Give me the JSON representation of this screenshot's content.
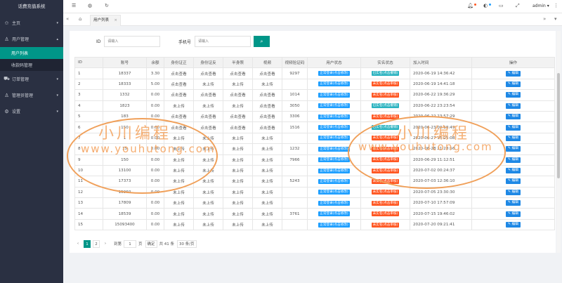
{
  "sidebar": {
    "title": "话费充值系统",
    "items": [
      {
        "icon": "star-icon",
        "glyph": "✩",
        "label": "主页",
        "chev": "▾"
      },
      {
        "icon": "user-icon",
        "glyph": "♙",
        "label": "用户管理",
        "chev": "▴"
      },
      {
        "icon": "cart-icon",
        "glyph": "⛟",
        "label": "订单管理",
        "chev": "▾"
      },
      {
        "icon": "admin-icon",
        "glyph": "♙",
        "label": "管理员管理",
        "chev": "▾"
      },
      {
        "icon": "gear-icon",
        "glyph": "⚙",
        "label": "设置",
        "chev": "▾"
      }
    ],
    "subitems": [
      {
        "label": "用户列表"
      },
      {
        "label": "收款码管理"
      }
    ]
  },
  "topbar": {
    "user": "admin ▾"
  },
  "tabs": {
    "active_label": "用户列表",
    "close": "×"
  },
  "search": {
    "id_label": "ID",
    "id_placeholder": "请输入",
    "phone_label": "手机号",
    "phone_placeholder": "请输入"
  },
  "table": {
    "columns": [
      "ID",
      "账号",
      "余额",
      "身份证正",
      "身份证反",
      "半身照",
      "视频",
      "视频验证码",
      "用户状态",
      "实名状态",
      "加入时间",
      "操作"
    ],
    "edit_label": "✎ 编辑",
    "rows": [
      {
        "id": "1",
        "acc": "18337",
        "bal": "3.30",
        "a": "点击查看",
        "b": "点击查看",
        "c": "点击查看",
        "d": "点击查看",
        "code": "9297",
        "status": "正常登录(点击修改)",
        "real": "已实名(点击撤销)",
        "real_kind": "teal",
        "time": "2020-06-19 14:36:42"
      },
      {
        "id": "2",
        "acc": "18333",
        "bal": "5.00",
        "a": "点击查看",
        "b": "未上传",
        "c": "未上传",
        "d": "未上传",
        "code": "",
        "status": "正常登录(点击修改)",
        "real": "未实名(点击审核)",
        "real_kind": "orange",
        "time": "2020-06-19 14:41:18"
      },
      {
        "id": "3",
        "acc": "1332",
        "bal": "0.00",
        "a": "点击查看",
        "b": "点击查看",
        "c": "点击查看",
        "d": "点击查看",
        "code": "1014",
        "status": "正常登录(点击修改)",
        "real": "未实名(点击审核)",
        "real_kind": "orange",
        "time": "2020-06-22 19:36:29"
      },
      {
        "id": "4",
        "acc": "1823",
        "bal": "0.00",
        "a": "未上传",
        "b": "未上传",
        "c": "未上传",
        "d": "点击查看",
        "code": "3050",
        "status": "正常登录(点击修改)",
        "real": "已实名(点击撤销)",
        "real_kind": "teal",
        "time": "2020-06-22 23:23:54"
      },
      {
        "id": "5",
        "acc": "183",
        "bal": "0.00",
        "a": "点击查看",
        "b": "点击查看",
        "c": "点击查看",
        "d": "点击查看",
        "code": "3306",
        "status": "正常登录(点击修改)",
        "real": "未实名(点击审核)",
        "real_kind": "orange",
        "time": "2020-06-22 23:57:29"
      },
      {
        "id": "6",
        "acc": "150",
        "bal": "0.00",
        "a": "点击查看",
        "b": "点击查看",
        "c": "点击查看",
        "d": "点击查看",
        "code": "1516",
        "status": "正常登录(点击修改)",
        "real": "已实名(点击撤销)",
        "real_kind": "teal",
        "time": "2020-06-23 00:18:49"
      },
      {
        "id": "7",
        "acc": "1",
        "bal": "0.00",
        "a": "未上传",
        "b": "未上传",
        "c": "未上传",
        "d": "未上传",
        "code": "",
        "status": "正常登录(点击修改)",
        "real": "未实名(点击审核)",
        "real_kind": "orange",
        "time": "2020-06-27 15:25:08"
      },
      {
        "id": "8",
        "acc": "15",
        "bal": "0.00",
        "a": "未上传",
        "b": "未上传",
        "c": "未上传",
        "d": "未上传",
        "code": "1232",
        "status": "正常登录(点击修改)",
        "real": "未实名(点击审核)",
        "real_kind": "orange",
        "time": "2020-06-28 21:28:56"
      },
      {
        "id": "9",
        "acc": "150",
        "bal": "0.00",
        "a": "未上传",
        "b": "未上传",
        "c": "未上传",
        "d": "未上传",
        "code": "7966",
        "status": "正常登录(点击修改)",
        "real": "未实名(点击审核)",
        "real_kind": "orange",
        "time": "2020-06-29 11:12:51"
      },
      {
        "id": "10",
        "acc": "13100",
        "bal": "0.00",
        "a": "未上传",
        "b": "未上传",
        "c": "未上传",
        "d": "未上传",
        "code": "",
        "status": "正常登录(点击修改)",
        "real": "未实名(点击审核)",
        "real_kind": "orange",
        "time": "2020-07-02 00:24:37"
      },
      {
        "id": "11",
        "acc": "17373",
        "bal": "0.00",
        "a": "未上传",
        "b": "未上传",
        "c": "未上传",
        "d": "未上传",
        "code": "5243",
        "status": "正常登录(点击修改)",
        "real": "未实名(点击审核)",
        "real_kind": "orange",
        "time": "2020-07-03 12:36:10"
      },
      {
        "id": "12",
        "acc": "15960",
        "bal": "0.00",
        "a": "未上传",
        "b": "未上传",
        "c": "未上传",
        "d": "未上传",
        "code": "",
        "status": "正常登录(点击修改)",
        "real": "未实名(点击审核)",
        "real_kind": "orange",
        "time": "2020-07-05 23:30:30"
      },
      {
        "id": "13",
        "acc": "17809",
        "bal": "0.00",
        "a": "未上传",
        "b": "未上传",
        "c": "未上传",
        "d": "未上传",
        "code": "",
        "status": "正常登录(点击修改)",
        "real": "未实名(点击审核)",
        "real_kind": "orange",
        "time": "2020-07-10 17:57:09"
      },
      {
        "id": "14",
        "acc": "18539",
        "bal": "0.00",
        "a": "未上传",
        "b": "未上传",
        "c": "未上传",
        "d": "未上传",
        "code": "3761",
        "status": "正常登录(点击修改)",
        "real": "未实名(点击审核)",
        "real_kind": "orange",
        "time": "2020-07-15 19:46:02"
      },
      {
        "id": "15",
        "acc": "15093400",
        "bal": "0.00",
        "a": "未上传",
        "b": "未上传",
        "c": "未上传",
        "d": "未上传",
        "code": "",
        "status": "正常登录(点击修改)",
        "real": "未实名(点击审核)",
        "real_kind": "orange",
        "time": "2020-07-20 09:21:41"
      }
    ]
  },
  "pager": {
    "prev": "‹",
    "p1": "1",
    "p2": "2",
    "next": "›",
    "goto": "到第",
    "page": "1",
    "page_unit": "页",
    "confirm": "确定",
    "total": "共 41 条",
    "per_page": "30 条/页"
  },
  "watermark": {
    "cn": "小川编程",
    "url": "www.youhutong.com"
  }
}
